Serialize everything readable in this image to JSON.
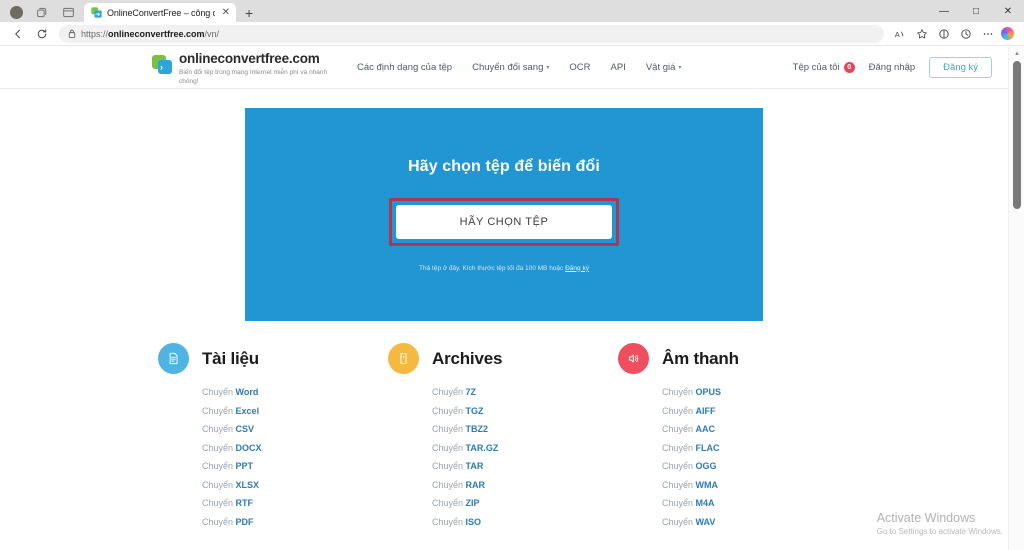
{
  "browser": {
    "tab": {
      "title": "OnlineConvertFree – công cụ chu",
      "favicon_icon": "convert-logo-icon",
      "close_icon": "close-icon",
      "newtab_label": "+"
    },
    "system_icons": [
      "profile-avatar-icon",
      "workspaces-icon",
      "tab-actions-icon"
    ],
    "window_controls": {
      "minimize": "—",
      "maximize": "□",
      "close": "✕"
    },
    "toolbar": {
      "back_icon": "back-arrow-icon",
      "refresh_icon": "refresh-icon",
      "url_lock_icon": "lock-icon",
      "url_prefix": "https://",
      "url_domain": "onlineconvertfree.com",
      "url_path": "/vn/",
      "read_aloud_icon": "read-aloud-icon",
      "favorite_icon": "star-icon",
      "collections_icon": "collections-icon",
      "history_icon": "history-icon",
      "settings_icon": "more-ellipsis-icon",
      "copilot_icon": "copilot-icon"
    }
  },
  "site": {
    "brand": {
      "name": "onlineconvertfree.com",
      "tagline": "Biến đổi tệp trong mạng Internet miễn phí và nhanh chóng!",
      "logo_icon": "convert-arrows-icon"
    },
    "nav": [
      {
        "label": "Các định dạng của tệp",
        "has_caret": false
      },
      {
        "label": "Chuyển đổi sang",
        "has_caret": true
      },
      {
        "label": "OCR",
        "has_caret": false
      },
      {
        "label": "API",
        "has_caret": false
      },
      {
        "label": "Vật giá",
        "has_caret": true
      }
    ],
    "header_right": {
      "my_files_label": "Tệp của tôi",
      "my_files_count": "0",
      "login_label": "Đăng nhập",
      "signup_label": "Đăng ký"
    },
    "hero": {
      "title": "Hãy chọn tệp để biến đổi",
      "button_label": "HÃY CHỌN TỆP",
      "note_text": "Thả tệp ở đây. Kích thước tệp tối đa 100 MB hoặc ",
      "note_link": "Đăng ký",
      "background_color": "#2196d3",
      "annotation_color": "#b13652"
    },
    "categories": [
      {
        "title": "Tài liệu",
        "icon": "document-icon",
        "icon_color": "#4fb3e3",
        "prefix": "Chuyển",
        "items": [
          "Word",
          "Excel",
          "CSV",
          "DOCX",
          "PPT",
          "XLSX",
          "RTF",
          "PDF"
        ]
      },
      {
        "title": "Archives",
        "icon": "archive-box-icon",
        "icon_color": "#f5b942",
        "prefix": "Chuyển",
        "items": [
          "7Z",
          "TGZ",
          "TBZ2",
          "TAR.GZ",
          "TAR",
          "RAR",
          "ZIP",
          "ISO"
        ]
      },
      {
        "title": "Âm thanh",
        "icon": "speaker-audio-icon",
        "icon_color": "#ee4e5e",
        "prefix": "Chuyển",
        "items": [
          "OPUS",
          "AIFF",
          "AAC",
          "FLAC",
          "OGG",
          "WMA",
          "M4A",
          "WAV"
        ]
      }
    ]
  },
  "watermark": {
    "line1": "Activate Windows",
    "line2": "Go to Settings to activate Windows."
  }
}
